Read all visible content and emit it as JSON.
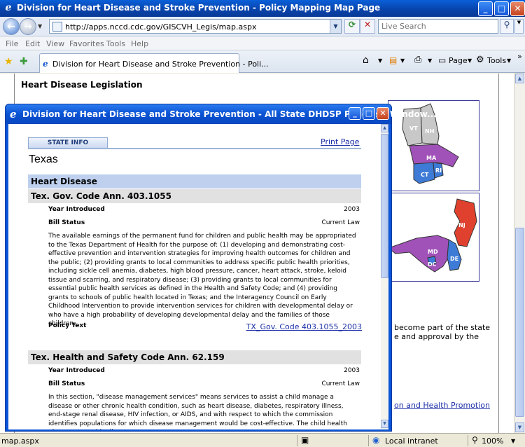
{
  "browser": {
    "window_title": "Division for Heart Disease and Stroke Prevention - Policy Mapping Map Page",
    "address_url": "http://apps.nccd.cdc.gov/GISCVH_Legis/map.aspx",
    "search_placeholder": "Live Search",
    "menu": [
      "File",
      "Edit",
      "View",
      "Favorites",
      "Tools",
      "Help"
    ],
    "tab_label": "Division for Heart Disease and Stroke Prevention - Poli...",
    "toolbar": {
      "page_label": "Page",
      "tools_label": "Tools"
    },
    "status": {
      "url": "map.aspx",
      "zone": "Local intranet",
      "zoom": "100%"
    }
  },
  "page": {
    "heading": "Heart Disease Legislation",
    "map_labels_box1": [
      "VT",
      "NH",
      "MA",
      "CT",
      "RI"
    ],
    "map_labels_box2": [
      "NJ",
      "MD",
      "DE",
      "DC"
    ],
    "bg_text_1": "become part of the state",
    "bg_text_2": "e and approval by the",
    "bg_link": "on and Health Promotion"
  },
  "popup": {
    "title": "Division for Heart Disease and Stroke Prevention - All State DHDSP Policies - Window...",
    "tab_label": "STATE INFO",
    "print_label": "Print Page",
    "state": "Texas",
    "section": "Heart Disease",
    "laws": [
      {
        "name": "Tex. Gov. Code Ann. 403.1055",
        "year_label": "Year Introduced",
        "year": "2003",
        "status_label": "Bill Status",
        "status": "Current Law",
        "description": "The available earnings of the permanent fund for children and public health may be appropriated to the Texas Department of Health for the purpose of: (1) developing and demonstrating cost-effective prevention and intervention strategies for improving health outcomes for children and the public; (2) providing grants to local communities to address specific public health priorities, including sickle cell anemia, diabetes, high blood pressure, cancer, heart attack, stroke, keloid tissue and scarring, and respiratory disease; (3) providing grants to local communities for essential public health services as defined in the Health and Safety Code; and (4) providing grants to schools of public health located in Texas; and the Interagency Council on Early Childhood Intervention to provide intervention services for children with developmental delay or who have a high probability of developing developmental delay and the families of those children.",
        "policy_text_label": "Policy Text",
        "policy_link": "TX_Gov. Code 403.1055_2003"
      },
      {
        "name": "Tex. Health and Safety Code Ann. 62.159",
        "year_label": "Year Introduced",
        "year": "2003",
        "status_label": "Bill Status",
        "status": "Current Law",
        "description": "In this section, \"disease management services\" means services to assist a child manage a disease or other chronic health condition, such as heart disease, diabetes, respiratory illness, end-stage renal disease, HIV infection, or AIDS, and with respect to which the commission identifies populations for which disease management would be cost-effective. The child health plan must provide disease"
      }
    ]
  },
  "colors": {
    "title_blue": "#0a52d2",
    "section_bar": "#bed0ee",
    "law_bar": "#e1e1e1",
    "link": "#1c2fa8",
    "map_purple": "#a052b8",
    "map_blue": "#3d7bd6",
    "map_gray": "#c8c8c8",
    "map_red": "#e0412e"
  }
}
